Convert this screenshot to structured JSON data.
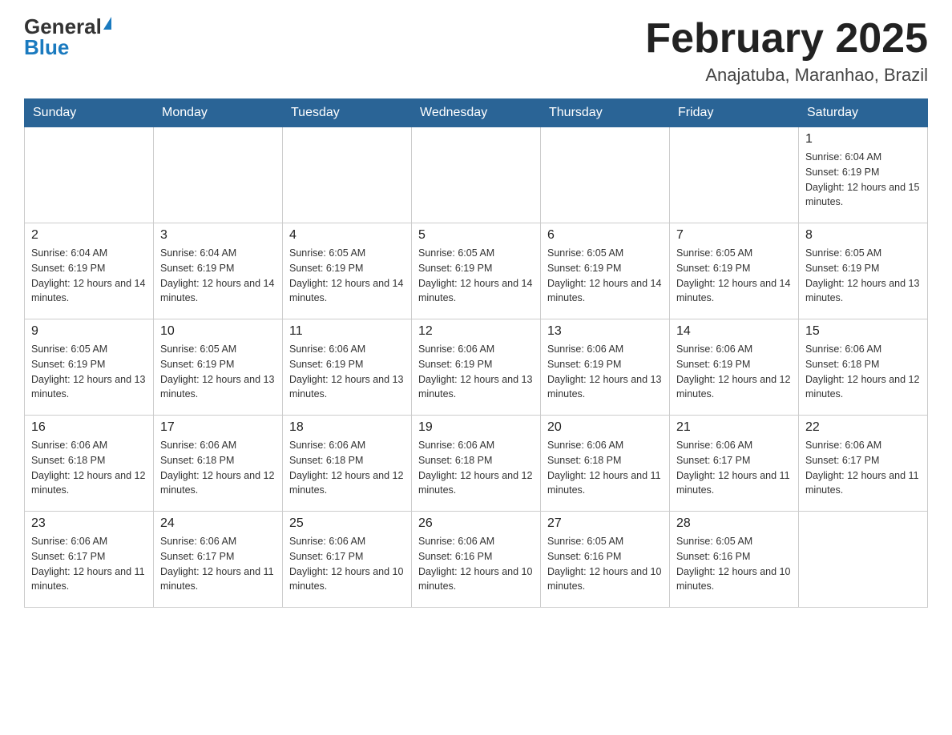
{
  "header": {
    "logo_general": "General",
    "logo_blue": "Blue",
    "month_title": "February 2025",
    "location": "Anajatuba, Maranhao, Brazil"
  },
  "days_of_week": [
    "Sunday",
    "Monday",
    "Tuesday",
    "Wednesday",
    "Thursday",
    "Friday",
    "Saturday"
  ],
  "weeks": [
    [
      {
        "day": "",
        "sunrise": "",
        "sunset": "",
        "daylight": ""
      },
      {
        "day": "",
        "sunrise": "",
        "sunset": "",
        "daylight": ""
      },
      {
        "day": "",
        "sunrise": "",
        "sunset": "",
        "daylight": ""
      },
      {
        "day": "",
        "sunrise": "",
        "sunset": "",
        "daylight": ""
      },
      {
        "day": "",
        "sunrise": "",
        "sunset": "",
        "daylight": ""
      },
      {
        "day": "",
        "sunrise": "",
        "sunset": "",
        "daylight": ""
      },
      {
        "day": "1",
        "sunrise": "Sunrise: 6:04 AM",
        "sunset": "Sunset: 6:19 PM",
        "daylight": "Daylight: 12 hours and 15 minutes."
      }
    ],
    [
      {
        "day": "2",
        "sunrise": "Sunrise: 6:04 AM",
        "sunset": "Sunset: 6:19 PM",
        "daylight": "Daylight: 12 hours and 14 minutes."
      },
      {
        "day": "3",
        "sunrise": "Sunrise: 6:04 AM",
        "sunset": "Sunset: 6:19 PM",
        "daylight": "Daylight: 12 hours and 14 minutes."
      },
      {
        "day": "4",
        "sunrise": "Sunrise: 6:05 AM",
        "sunset": "Sunset: 6:19 PM",
        "daylight": "Daylight: 12 hours and 14 minutes."
      },
      {
        "day": "5",
        "sunrise": "Sunrise: 6:05 AM",
        "sunset": "Sunset: 6:19 PM",
        "daylight": "Daylight: 12 hours and 14 minutes."
      },
      {
        "day": "6",
        "sunrise": "Sunrise: 6:05 AM",
        "sunset": "Sunset: 6:19 PM",
        "daylight": "Daylight: 12 hours and 14 minutes."
      },
      {
        "day": "7",
        "sunrise": "Sunrise: 6:05 AM",
        "sunset": "Sunset: 6:19 PM",
        "daylight": "Daylight: 12 hours and 14 minutes."
      },
      {
        "day": "8",
        "sunrise": "Sunrise: 6:05 AM",
        "sunset": "Sunset: 6:19 PM",
        "daylight": "Daylight: 12 hours and 13 minutes."
      }
    ],
    [
      {
        "day": "9",
        "sunrise": "Sunrise: 6:05 AM",
        "sunset": "Sunset: 6:19 PM",
        "daylight": "Daylight: 12 hours and 13 minutes."
      },
      {
        "day": "10",
        "sunrise": "Sunrise: 6:05 AM",
        "sunset": "Sunset: 6:19 PM",
        "daylight": "Daylight: 12 hours and 13 minutes."
      },
      {
        "day": "11",
        "sunrise": "Sunrise: 6:06 AM",
        "sunset": "Sunset: 6:19 PM",
        "daylight": "Daylight: 12 hours and 13 minutes."
      },
      {
        "day": "12",
        "sunrise": "Sunrise: 6:06 AM",
        "sunset": "Sunset: 6:19 PM",
        "daylight": "Daylight: 12 hours and 13 minutes."
      },
      {
        "day": "13",
        "sunrise": "Sunrise: 6:06 AM",
        "sunset": "Sunset: 6:19 PM",
        "daylight": "Daylight: 12 hours and 13 minutes."
      },
      {
        "day": "14",
        "sunrise": "Sunrise: 6:06 AM",
        "sunset": "Sunset: 6:19 PM",
        "daylight": "Daylight: 12 hours and 12 minutes."
      },
      {
        "day": "15",
        "sunrise": "Sunrise: 6:06 AM",
        "sunset": "Sunset: 6:18 PM",
        "daylight": "Daylight: 12 hours and 12 minutes."
      }
    ],
    [
      {
        "day": "16",
        "sunrise": "Sunrise: 6:06 AM",
        "sunset": "Sunset: 6:18 PM",
        "daylight": "Daylight: 12 hours and 12 minutes."
      },
      {
        "day": "17",
        "sunrise": "Sunrise: 6:06 AM",
        "sunset": "Sunset: 6:18 PM",
        "daylight": "Daylight: 12 hours and 12 minutes."
      },
      {
        "day": "18",
        "sunrise": "Sunrise: 6:06 AM",
        "sunset": "Sunset: 6:18 PM",
        "daylight": "Daylight: 12 hours and 12 minutes."
      },
      {
        "day": "19",
        "sunrise": "Sunrise: 6:06 AM",
        "sunset": "Sunset: 6:18 PM",
        "daylight": "Daylight: 12 hours and 12 minutes."
      },
      {
        "day": "20",
        "sunrise": "Sunrise: 6:06 AM",
        "sunset": "Sunset: 6:18 PM",
        "daylight": "Daylight: 12 hours and 11 minutes."
      },
      {
        "day": "21",
        "sunrise": "Sunrise: 6:06 AM",
        "sunset": "Sunset: 6:17 PM",
        "daylight": "Daylight: 12 hours and 11 minutes."
      },
      {
        "day": "22",
        "sunrise": "Sunrise: 6:06 AM",
        "sunset": "Sunset: 6:17 PM",
        "daylight": "Daylight: 12 hours and 11 minutes."
      }
    ],
    [
      {
        "day": "23",
        "sunrise": "Sunrise: 6:06 AM",
        "sunset": "Sunset: 6:17 PM",
        "daylight": "Daylight: 12 hours and 11 minutes."
      },
      {
        "day": "24",
        "sunrise": "Sunrise: 6:06 AM",
        "sunset": "Sunset: 6:17 PM",
        "daylight": "Daylight: 12 hours and 11 minutes."
      },
      {
        "day": "25",
        "sunrise": "Sunrise: 6:06 AM",
        "sunset": "Sunset: 6:17 PM",
        "daylight": "Daylight: 12 hours and 10 minutes."
      },
      {
        "day": "26",
        "sunrise": "Sunrise: 6:06 AM",
        "sunset": "Sunset: 6:16 PM",
        "daylight": "Daylight: 12 hours and 10 minutes."
      },
      {
        "day": "27",
        "sunrise": "Sunrise: 6:05 AM",
        "sunset": "Sunset: 6:16 PM",
        "daylight": "Daylight: 12 hours and 10 minutes."
      },
      {
        "day": "28",
        "sunrise": "Sunrise: 6:05 AM",
        "sunset": "Sunset: 6:16 PM",
        "daylight": "Daylight: 12 hours and 10 minutes."
      },
      {
        "day": "",
        "sunrise": "",
        "sunset": "",
        "daylight": ""
      }
    ]
  ]
}
